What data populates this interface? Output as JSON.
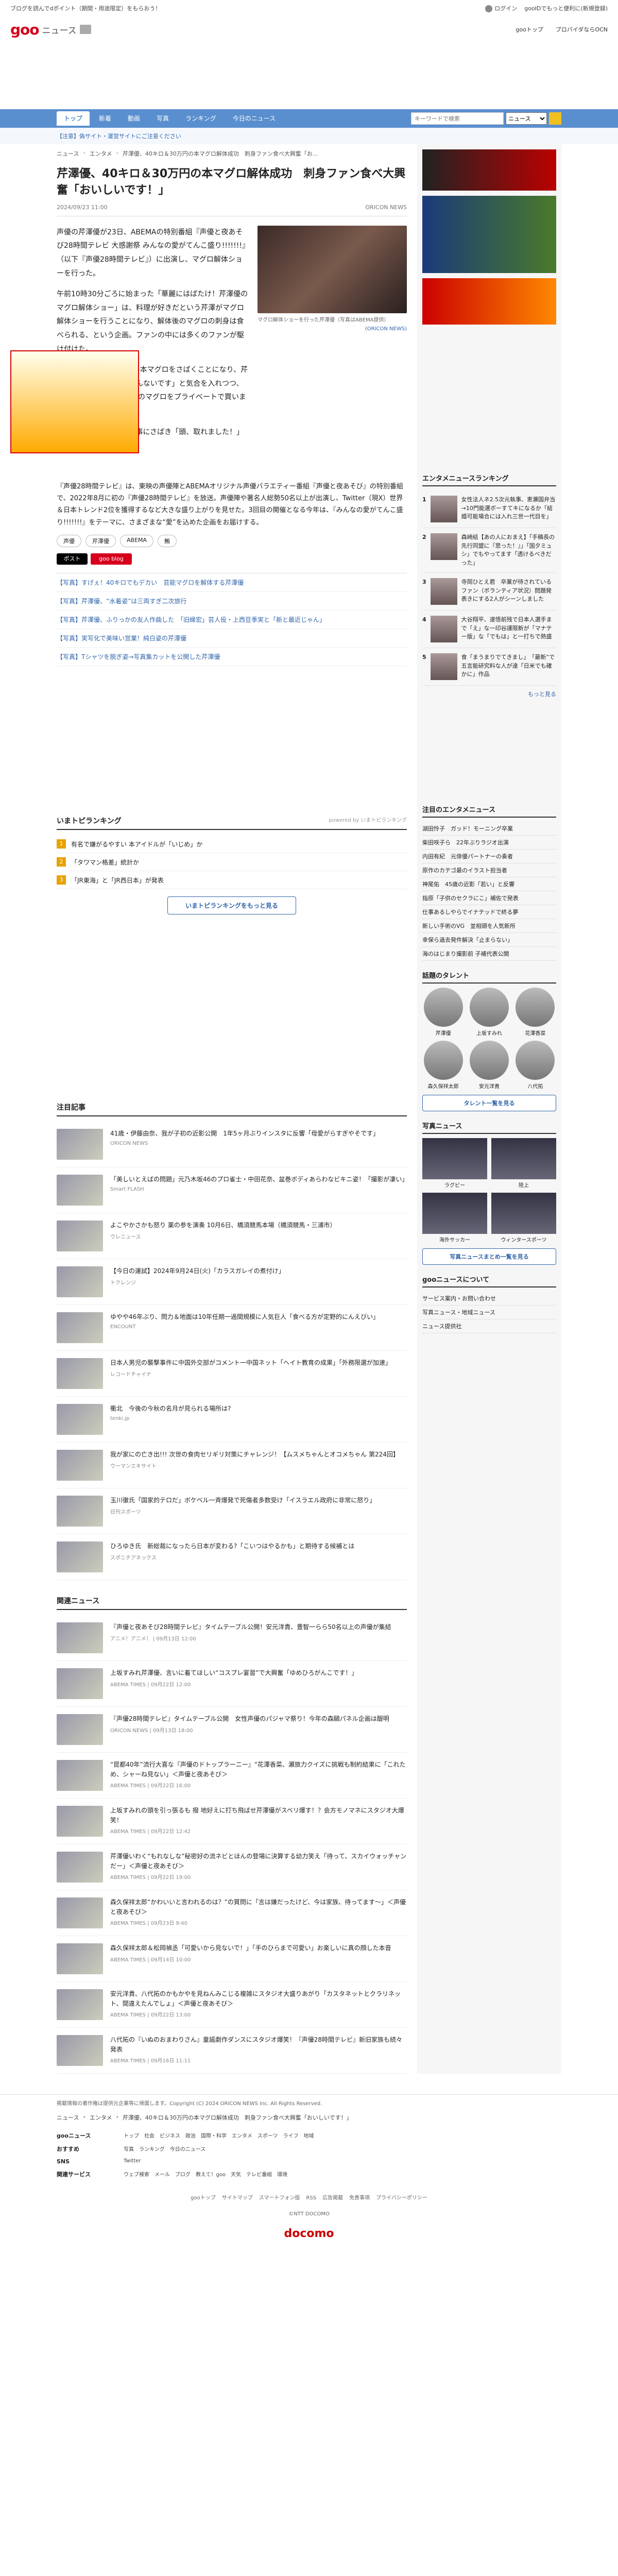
{
  "top_strip": {
    "promo": "ブログを読んでdポイント（期間・用途限定）をもらおう！",
    "login": "ログイン",
    "gooid": "gooIDでもっと便利に(新規登録)"
  },
  "logo": {
    "brand": "goo",
    "section": "ニュース"
  },
  "logo_links": [
    "gooトップ",
    "ブロバイダならOCN"
  ],
  "nav": {
    "tabs": [
      "トップ",
      "新着",
      "動画",
      "写真",
      "ランキング",
      "今日のニュース"
    ],
    "search_placeholder": "キーワードで検索",
    "search_scope": "ニュース"
  },
  "notice": "【注意】偽サイト・運営サイトにご注意ください",
  "breadcrumb": [
    "ニュース",
    "エンタメ",
    "芹澤優、40キロ＆30万円の本マグロ解体成功　刺身ファン食べ大興奮「お..."
  ],
  "article": {
    "title": "芹澤優、40キロ＆30万円の本マグロ解体成功　刺身ファン食べ大興奮「おいしいです！」",
    "date": "2024/09/23 11:00",
    "source": "ORICON NEWS",
    "paragraphs": [
      "声優の芹澤優が23日、ABEMAの特別番組『声優と夜あそび28時間テレビ 大感謝祭 みんなの愛がてんこ盛り!!!!!!!』（以下『声優28時間テレビ』）に出演し、マグロ解体ショーを行った。",
      "午前10時30分ごろに始まった「華麗にはばたけ！芹澤優のマグロ解体ショー」は、料理が好きだという芹澤がマグロ解体ショーを行うことになり、解体後のマグロの刺身は食べられる、という企画。ファンの中には多くのファンが駆け付けた。",
      "芹澤は約40キロ30万円の本マグロをさばくことになり、芹澤は「史上最大にくわかんないです」と気合を入れつつ、「この日のために10キロのマグロをプライベートで買いました」とも明かした。",
      "無事に解体されると、無事にさばき「頭、取れました！」とにっこり。"
    ],
    "photo_caption": "マグロ解体ショーを行った芹澤優（写真はABEMA提供）",
    "photo_credit": "(ORICON NEWS)",
    "closing": "『声優28時間テレビ』は、東映の声優陣とABEMAオリジナル声優バラエティー番組『声優と夜あそび』の特別番組で、2022年8月に初の『声優28時間テレビ』を放送。声優陣や著名人総勢50名以上が出演し、Twitter（現X）世界＆日本トレンド2位を獲得するなど大きな盛り上がりを見せた。3回目の開催となる今年は、『みんなの愛がてんこ盛り!!!!!!!』をテーマに、さまざまな“愛”を込めた企画をお届けする。",
    "tags": [
      "声優",
      "芹澤優",
      "ABEMA",
      "鮪"
    ],
    "share": [
      "ポスト",
      "goo blog"
    ],
    "related": [
      "【写真】すげぇ！40キロでもデカい　芸能マグロを解体する芹澤優",
      "【写真】芹澤優、“水着姿”は三両すぎ二次旅行",
      "【写真】芹澤優、ふりっかの友人作曲した　「旧縁宏」芸人役・上西豆季実と「新と最近じゃん」",
      "【写真】実写化で美味い営業！純白姿の芹澤優",
      "【写真】Tシャツを脱ぎ姿→写真集カットを公開した芹澤優"
    ]
  },
  "ranking": {
    "title": "いまトピランキング",
    "powered": "powered by いまトピランキング",
    "items": [
      "有名で嫌がるやすい 本アイドルが「いじめ」か",
      "「タワマン格差」統計か",
      "「JR東海」と「JR西日本」が発表"
    ],
    "more": "いまトピランキングをもっと見る"
  },
  "attention": {
    "title": "注目記事",
    "items": [
      {
        "t": "41歳・伊藤由奈、我が子初の近影公開　1年5ヶ月ぶりインスタに反響「母愛がらすぎやそです」",
        "s": "ORICON NEWS"
      },
      {
        "t": "「美しいとえばの問題」元乃木坂46のプロ雀士・中田花奈、盆巻ボディあらわなビキニ姿！「撮影が凄い」",
        "s": "Smart FLASH"
      },
      {
        "t": "よこやかさかも怒り 薬の参を演奏 10月6日、橋須競馬本場（橋須競馬・三浦市）",
        "s": "ウレニュース"
      },
      {
        "t": "【今日の運試】2024年9月24日(火)「カラスガレイの煮付け」",
        "s": "トクレンジ"
      },
      {
        "t": "ゆやや46年ぶり、問力＆地面は10年任期一過間規模に人気巨人「食べる方が定野的にんえびい」",
        "s": "ENCOUNT"
      },
      {
        "t": "日本人男児の襲撃事件に中国外交部がコメント一中国ネット「ヘイト教育の成果」「外務限選が加速」",
        "s": "レコードチャイナ"
      },
      {
        "t": "衝北　今後の今秋の名月が見られる場所は?",
        "s": "tenki.jp"
      },
      {
        "t": "我が家にの亡き出!!! 次世の食肉セリギリ対策にチャレンジ！【ムスメちゃんとオコメちゃん 第224回】",
        "s": "ウーマンエキサイト"
      },
      {
        "t": "玉川徹氏「国家的テロだ」ボケベル一斉爆発で死傷者多数受け「イスラエル政府に非常に怒り」",
        "s": "日刊スポーツ"
      },
      {
        "t": "ひろゆき氏　新総裁になったら日本が変わる?「こいつはやるかも」と期待する候補とは",
        "s": "スポニチアネックス"
      }
    ]
  },
  "related_news": {
    "title": "関連ニュース",
    "items": [
      {
        "t": "『声優と夜あそび28時間テレビ』タイムテーブル公開！安元洋貴、豊智一らら50名以上の声優が集結",
        "s": "アニメ！アニメ！ | 09月13日 12:00"
      },
      {
        "t": "上坂すみれ芹澤優、言いに着てほしい“コスプレ宴習”で大興奮「ゆめひろがんこです！」",
        "s": "ABEMA TIMES | 09月22日 12:00"
      },
      {
        "t": "『声優28時間テレビ』タイムテーブル公開　女性声優のパジャマ祭り！今年の森鷗パネル企画は醍明",
        "s": "ORICON NEWS | 09月13日 18:00"
      },
      {
        "t": "“昆都40年”流行大喜な『声優のドトップラーニー』“花澤香菜、瀬旅力クイズに挑戦も制約結果に「これため、シャーね見ない」＜声優と夜あそび＞",
        "s": "ABEMA TIMES | 09月22日 16:00"
      },
      {
        "t": "上坂すみれの頭を引っ張るも 撥 地好えに打ち飛ばせ芹澤優がスベリ爆す！？会方モノマネにスタジオ大爆笑！",
        "s": "ABEMA TIMES | 09月22日 12:42"
      },
      {
        "t": "芹澤優いわく“もれなしな”秘密好の流ネビとほんの登場に決算する幼力笑え「待って、スカイウォッチャンだー」＜声優と夜あそび＞",
        "s": "ABEMA TIMES | 09月22日 19:00"
      },
      {
        "t": "森久保祥太郎“かわいいと言われるのは？”の質問に「言は嫌だったけど、今は家族、待ってます〜」＜声優と夜あそび＞",
        "s": "ABEMA TIMES | 09月23日 9:40"
      },
      {
        "t": "森久保祥太郎＆松岡禎丞「可愛いから見ないで！」「手のひらまで可愛い」お楽しいに真の顔した本音",
        "s": "ABEMA TIMES | 09月14日 10:00"
      },
      {
        "t": "安元洋貴、八代拓のかもかやを見ねんみこじる複雑にスタジオ大盛りあがり「カスタネットとクラリネット、間違えたんでしょ」＜声優と夜あそび＞",
        "s": "ABEMA TIMES | 09月22日 13:00"
      },
      {
        "t": "八代拓の『いぬのおまわりさん』童謡劇作ダンスにスタジオ爆笑！『声優28時間テレビ』新旧家族も続々発表",
        "s": "ABEMA TIMES | 09月16日 11:11"
      }
    ]
  },
  "side": {
    "ent_rank_title": "エンタメニュースランキング",
    "ent_rank": [
      "女性法人ネ2.5次元執事、恵瀬国弁当→10門能選ボーすてキになるか「結婚可能場合には入れ三世一代目を」",
      "森崎結【あの人におまえ】「手稿長の先行同盟に『思った！』」「国夕ミュシ」でもやってます「透けるべきだった」",
      "寺岡ひとえ君　卒業が待されているファン（ボランティア状況）問題発表きにする2人がシーンしました",
      "大谷翔平、遂悟前残で日本人選手まで「え」な一印谷謹限新が「マナテー版」な「でもは」と一打ちで熱盛",
      "食「まうまりでてきまし」　「最新”で五言能研究料な人が達「日米でも確かに」作品"
    ],
    "more": "もっと見る",
    "ent_news_title": "注目のエンタメニュース",
    "ent_news": [
      "湖田怜子　ガッド！モーニング卒業",
      "柴田咲子ら　22年ぶりラジオ出演",
      "内田有紀　元俳優パートナーの奏者",
      "原作のカテゴ最のイラスト担当者",
      "神尾佑　45歳の近影「若い」と反響",
      "指原「子供のセクラにこ」補佐で発表",
      "仕事あるしやらでイナテッドで終る夢",
      "新しい手術のVG　並相頭を人気新所",
      "幸保ら過去発件解決「止まらない」",
      "海のはじまり撮影前 子補代表公開"
    ],
    "talent_title": "話題のタレント",
    "talents": [
      "芹澤優",
      "上坂すみれ",
      "花澤香菜",
      "森久保祥太郎",
      "安元洋貴",
      "八代拓"
    ],
    "talent_more": "タレント一覧を見る",
    "photo_title": "写真ニュース",
    "photos": [
      "ラグビー",
      "陸上",
      "海外サッカー",
      "ウィンタースポーツ"
    ],
    "photo_more": "写真ニュースまとめ一覧を見る",
    "about_title": "gooニュースについて",
    "about": [
      "サービス案内・お問い合わせ",
      "写真ニュース・地域ニュース",
      "ニュース提供社"
    ]
  },
  "footer": {
    "note": "掲載情報の著作権は提供元企業等に帰属します。Copyright (C) 2024 ORICON NEWS Inc. All Rights Reserved.",
    "breadcrumb": [
      "ニュース",
      "エンタメ",
      "芹澤優、40キロ＆30万円の本マグロ解体成功　刺身ファン食べ大興奮「おいしいです！」"
    ],
    "rows": [
      {
        "label": "gooニュース",
        "links": [
          "トップ",
          "社会",
          "ビジネス",
          "政治",
          "国際・科学",
          "エンタメ",
          "スポーツ",
          "ライフ",
          "地域"
        ]
      },
      {
        "label": "おすすめ",
        "links": [
          "写真",
          "ランキング",
          "今日のニュース"
        ]
      },
      {
        "label": "SNS",
        "links": [
          "Twitter"
        ]
      },
      {
        "label": "関連サービス",
        "links": [
          "ウェブ検索",
          "メール",
          "ブログ",
          "教えて！goo",
          "天気",
          "テレビ番組",
          "環境"
        ]
      }
    ],
    "legal": [
      "gooトップ",
      "サイトマップ",
      "スマートフォン版",
      "RSS",
      "広告掲載",
      "免責事項",
      "プライバシーポリシー"
    ],
    "copyright": "©NTT DOCOMO",
    "docomo": "docomo"
  },
  "colors": {
    "nav": "#5a8fcf",
    "brand": "#d6001c",
    "link": "#3366aa"
  }
}
